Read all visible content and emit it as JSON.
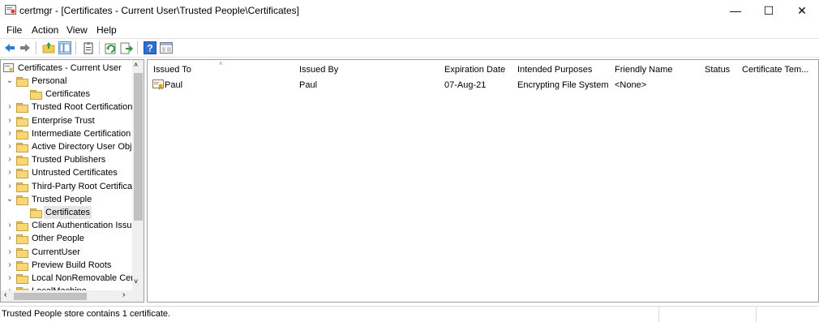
{
  "window": {
    "title": "certmgr - [Certificates - Current User\\Trusted People\\Certificates]",
    "controls": {
      "minimize": "—",
      "maximize": "☐",
      "close": "✕"
    }
  },
  "menu": [
    "File",
    "Action",
    "View",
    "Help"
  ],
  "toolbar": {
    "icons": [
      "back-arrow-icon",
      "forward-arrow-icon",
      "up-folder-icon",
      "show-hide-console-tree-icon",
      "clipboard-icon",
      "refresh-icon",
      "export-list-icon",
      "help-icon",
      "show-action-pane-icon"
    ]
  },
  "tree": {
    "root": "Certificates - Current User",
    "nodes": [
      {
        "label": "Personal",
        "expanded": true
      },
      {
        "label": "Certificates",
        "child": true
      },
      {
        "label": "Trusted Root Certification Authorities"
      },
      {
        "label": "Enterprise Trust"
      },
      {
        "label": "Intermediate Certification Authorities"
      },
      {
        "label": "Active Directory User Object"
      },
      {
        "label": "Trusted Publishers"
      },
      {
        "label": "Untrusted Certificates"
      },
      {
        "label": "Third-Party Root Certification Authorities"
      },
      {
        "label": "Trusted People",
        "expanded": true
      },
      {
        "label": "Certificates",
        "child": true,
        "selected": true
      },
      {
        "label": "Client Authentication Issuers"
      },
      {
        "label": "Other People"
      },
      {
        "label": "CurrentUser"
      },
      {
        "label": "Preview Build Roots"
      },
      {
        "label": "Local NonRemovable Certificates"
      },
      {
        "label": "LocalMachine"
      }
    ]
  },
  "list": {
    "columns": [
      "Issued To",
      "Issued By",
      "Expiration Date",
      "Intended Purposes",
      "Friendly Name",
      "Status",
      "Certificate Tem..."
    ],
    "rows": [
      {
        "issued_to": "Paul",
        "issued_by": "Paul",
        "expiration": "07-Aug-21",
        "purposes": "Encrypting File System",
        "friendly": "<None>",
        "status": "",
        "template": ""
      }
    ]
  },
  "status": "Trusted People store contains 1 certificate."
}
